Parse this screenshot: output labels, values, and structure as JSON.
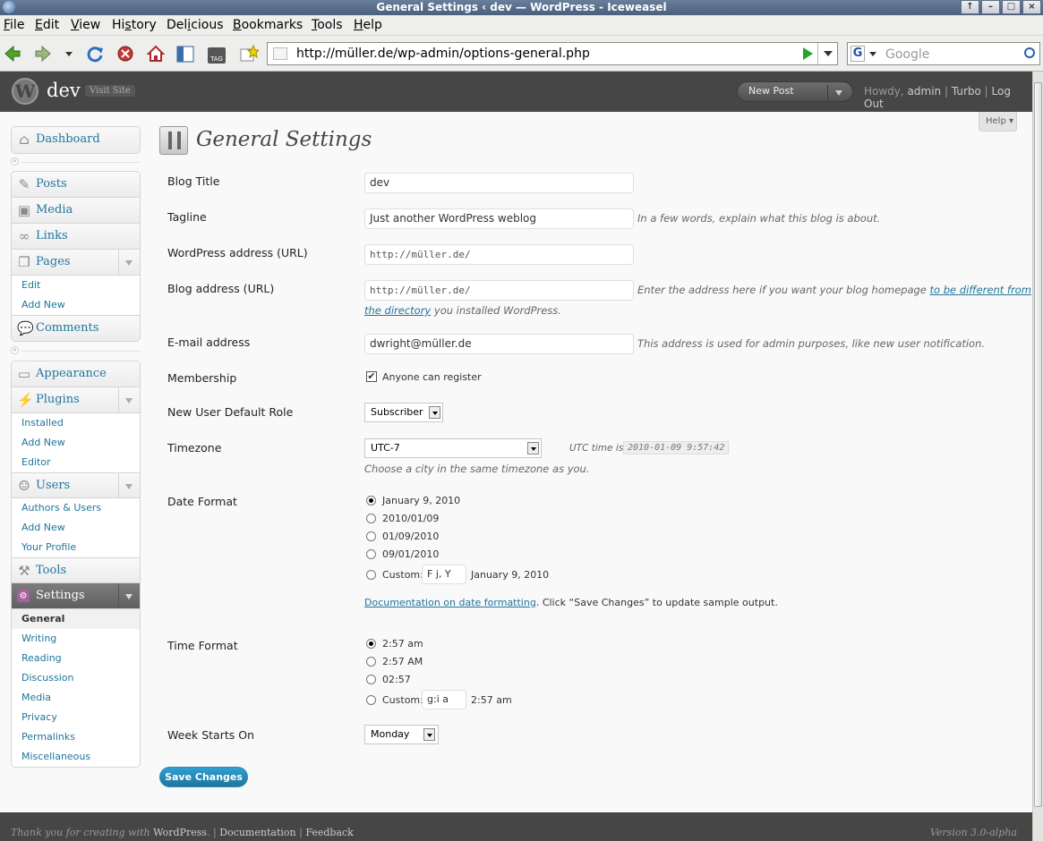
{
  "window": {
    "title": "General Settings ‹ dev — WordPress - Iceweasel"
  },
  "menubar": {
    "items": [
      {
        "u": "F",
        "rest": "ile"
      },
      {
        "u": "E",
        "rest": "dit"
      },
      {
        "u": "V",
        "rest": "iew"
      },
      {
        "pre": "Hi",
        "u": "s",
        "rest": "tory"
      },
      {
        "pre": "Del",
        "u": "i",
        "rest": "cious"
      },
      {
        "u": "B",
        "rest": "ookmarks"
      },
      {
        "u": "T",
        "rest": "ools"
      },
      {
        "u": "H",
        "rest": "elp"
      }
    ]
  },
  "browser": {
    "url": "http://müller.de/wp-admin/options-general.php",
    "search_placeholder": "Google"
  },
  "wphead": {
    "site_name": "dev",
    "visit_site": "Visit Site",
    "new_post": "New Post",
    "howdy": "Howdy,",
    "user": "admin",
    "turbo": "Turbo",
    "logout": "Log Out",
    "help": "Help"
  },
  "sidebar": {
    "dashboard": "Dashboard",
    "posts": "Posts",
    "media": "Media",
    "links": "Links",
    "pages": "Pages",
    "pages_sub": [
      "Edit",
      "Add New"
    ],
    "comments": "Comments",
    "appearance": "Appearance",
    "plugins": "Plugins",
    "plugins_sub": [
      "Installed",
      "Add New",
      "Editor"
    ],
    "users": "Users",
    "users_sub": [
      "Authors & Users",
      "Add New",
      "Your Profile"
    ],
    "tools": "Tools",
    "settings": "Settings",
    "settings_sub": [
      "General",
      "Writing",
      "Reading",
      "Discussion",
      "Media",
      "Privacy",
      "Permalinks",
      "Miscellaneous"
    ]
  },
  "page": {
    "title": "General Settings",
    "blog_title_label": "Blog Title",
    "blog_title_value": "dev",
    "tagline_label": "Tagline",
    "tagline_value": "Just another WordPress weblog",
    "tagline_desc": "In a few words, explain what this blog is about.",
    "wp_address_label": "WordPress address (URL)",
    "wp_address_value": "http://müller.de/",
    "blog_address_label": "Blog address (URL)",
    "blog_address_value": "http://müller.de/",
    "blog_address_desc_1": "Enter the address here if you want your blog homepage",
    "blog_address_link_1": "to be different from",
    "blog_address_link_2": "the directory",
    "blog_address_desc_2": "you installed WordPress.",
    "email_label": "E-mail address",
    "email_value": "dwright@müller.de",
    "email_desc": "This address is used for admin purposes, like new user notification.",
    "membership_label": "Membership",
    "membership_check": "Anyone can register",
    "role_label": "New User Default Role",
    "role_value": "Subscriber",
    "timezone_label": "Timezone",
    "timezone_value": "UTC-7",
    "utc_label": "UTC time is",
    "utc_value": "2010-01-09 9:57:42",
    "timezone_desc": "Choose a city in the same timezone as you.",
    "date_format_label": "Date Format",
    "date_options": [
      "January 9, 2010",
      "2010/01/09",
      "01/09/2010",
      "09/01/2010"
    ],
    "custom_label": "Custom:",
    "date_custom_value": "F j, Y",
    "date_custom_sample": "January 9, 2010",
    "date_doc_link": "Documentation on date formatting",
    "date_doc_rest": ". Click “Save Changes” to update sample output.",
    "time_format_label": "Time Format",
    "time_options": [
      "2:57 am",
      "2:57 AM",
      "02:57"
    ],
    "time_custom_value": "g:i a",
    "time_custom_sample": "2:57 am",
    "week_label": "Week Starts On",
    "week_value": "Monday",
    "save": "Save Changes"
  },
  "footer": {
    "thanks_pre": "Thank you for creating with",
    "thanks_link": "WordPress",
    "sep1": ". |",
    "documentation": "Documentation",
    "sep2": "|",
    "feedback": "Feedback",
    "version": "Version 3.0-alpha"
  }
}
